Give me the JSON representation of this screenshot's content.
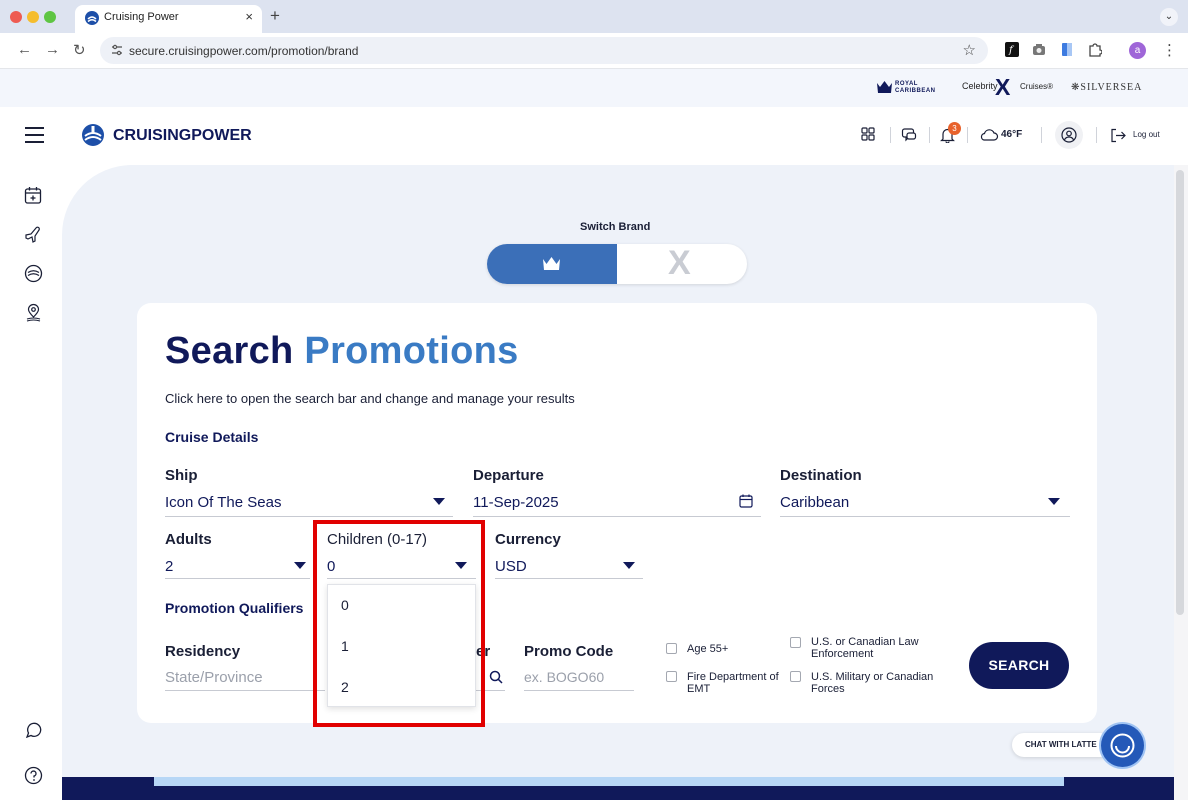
{
  "browser": {
    "tab_title": "Cruising Power",
    "tab_close": "×",
    "new_tab": "+",
    "tab_menu": "⌄",
    "url": "secure.cruisingpower.com/promotion/brand",
    "back": "←",
    "forward": "→",
    "reload": "↻",
    "bookmark": "☆",
    "profile_initial": "a",
    "menu": "⋮"
  },
  "brand_bar": {
    "royal_caribbean": "ROYAL\nCARIBBEAN",
    "celebrity": "Celebrity",
    "celebrity_x": "X",
    "celebrity_cruises": "Cruises®",
    "silversea": "❋SILVERSEA"
  },
  "header": {
    "logo_text": "CRUISINGPOWER",
    "notification_count": "3",
    "temperature": "46°F",
    "logout_label": "Log out"
  },
  "switch_brand": {
    "label": "Switch Brand",
    "celebrity_option": "X"
  },
  "search": {
    "title_part1": "Search",
    "title_part2": "Promotions",
    "subtitle": "Click here to open the search bar and change and manage your results",
    "cruise_details_heading": "Cruise Details",
    "ship_label": "Ship",
    "ship_value": "Icon Of The Seas",
    "departure_label": "Departure",
    "departure_value": "11-Sep-2025",
    "destination_label": "Destination",
    "destination_value": "Caribbean",
    "adults_label": "Adults",
    "adults_value": "2",
    "children_label": "Children (0-17)",
    "children_value": "0",
    "children_options": [
      "0",
      "1",
      "2"
    ],
    "currency_label": "Currency",
    "currency_value": "USD",
    "qualifiers_heading": "Promotion Qualifiers",
    "residency_label": "Residency",
    "residency_placeholder": "State/Province",
    "partial_label": "er",
    "promo_label": "Promo Code",
    "promo_placeholder": "ex. BOGO60",
    "checkboxes": [
      "Age 55+",
      "Fire Department of EMT",
      "U.S. or Canadian Law Enforcement",
      "U.S. Military or Canadian Forces"
    ],
    "search_button": "SEARCH"
  },
  "chat": {
    "label": "CHAT WITH LATTE"
  }
}
